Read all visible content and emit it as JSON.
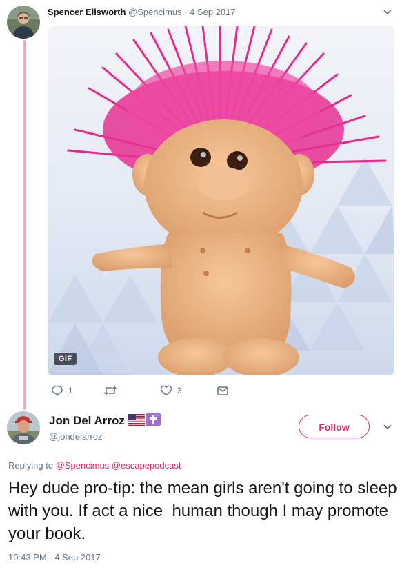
{
  "tweet1": {
    "author_name": "Spencer Ellsworth",
    "author_handle": "@Spencimus",
    "separator": "·",
    "date": "4 Sep 2017",
    "media_badge": "GIF",
    "media_description_icon": "troll-doll-gif",
    "actions": {
      "reply_count": "1",
      "retweet_count": "",
      "like_count": "3"
    }
  },
  "tweet2": {
    "author_name": "Jon Del Arroz",
    "author_handle": "@jondelarroz",
    "follow_label": "Follow",
    "replying_prefix": "Replying to",
    "mention_1": "@Spencimus",
    "mention_2": "@escapepodcast",
    "text": "Hey dude pro-tip: the mean girls aren't going to sleep with you. If act a nice  human though I may promote your book.",
    "timestamp": "10:43 PM - 4 Sep 2017"
  },
  "colors": {
    "accent": "#e0245e",
    "muted": "#657786",
    "thread_line": "#f5a3bf"
  }
}
